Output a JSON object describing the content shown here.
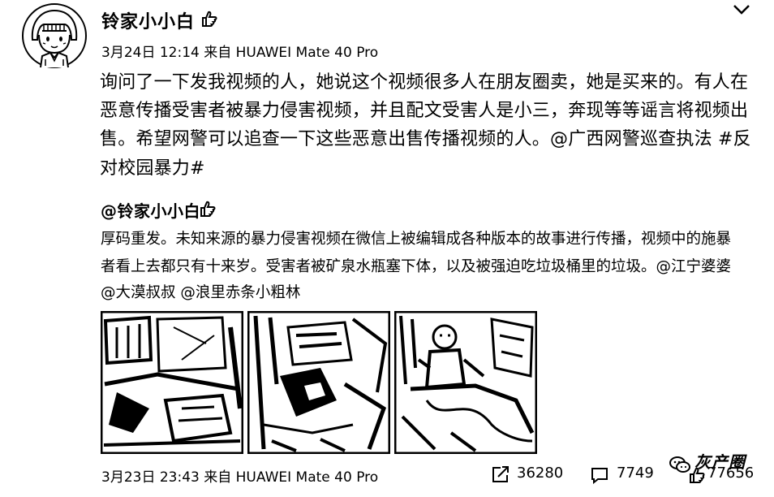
{
  "post": {
    "username": "铃家小小白",
    "meta": "3月24日 12:14 来自 HUAWEI Mate 40 Pro",
    "text_lines": [
      "询问了一下发我视频的人，她说这个视频很多人在朋友圈卖，她是买来的。有人在",
      "恶意传播受害者被暴力侵害视频，并且配文受害人是小三，奔现等等谣言将视频出",
      "售。希望网警可以追查一下这些恶意出售传播视频的人。@广西网警巡查执法 #反",
      "对校园暴力#"
    ]
  },
  "repost": {
    "username": "@铃家小小白",
    "text_lines": [
      "厚码重发。未知来源的暴力侵害视频在微信上被编辑成各种版本的故事进行传播，视频中的施暴",
      "者看上去都只有十来岁。受害者被矿泉水瓶塞下体，以及被强迫吃垃圾桶里的垃圾。@江宁婆婆",
      "@大漠叔叔 @浪里赤条小粗林"
    ],
    "image_count": 3,
    "meta": "3月23日 23:43 来自 HUAWEI Mate 40 Pro",
    "stats": {
      "shares": "36280",
      "comments": "7749",
      "likes": "77656"
    }
  },
  "watermark": "灰产圈",
  "icons": {
    "avatar": "cartoon-girl-avatar",
    "badge": "member-badge-icon",
    "menu": "chevron-down-icon",
    "share": "share-icon",
    "comment": "comment-icon",
    "like": "like-icon",
    "watermark": "wechat-icon"
  },
  "colors": {
    "text": "#000000",
    "background": "#ffffff"
  }
}
